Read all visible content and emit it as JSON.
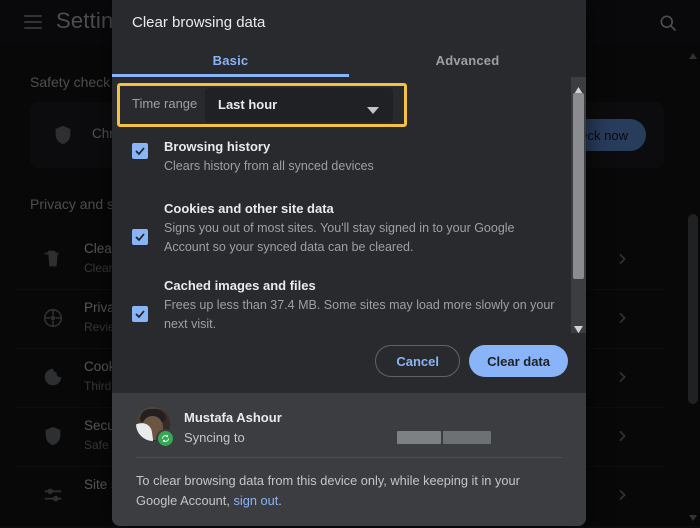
{
  "background": {
    "app_title": "Settings",
    "menu_icon": "hamburger-menu-icon",
    "search_icon": "search-icon",
    "safety_section_title": "Safety check",
    "safety_row_label": "Chro",
    "check_now_label": "eck now",
    "privacy_section_title": "Privacy and s",
    "rows": [
      {
        "title": "Clear",
        "subtitle": "Clear",
        "icon": "trash-icon"
      },
      {
        "title": "Priva",
        "subtitle": "Revie",
        "icon": "privacy-guide-icon"
      },
      {
        "title": "Cook",
        "subtitle": "Third",
        "icon": "cookie-icon"
      },
      {
        "title": "Secu",
        "subtitle": "Safe",
        "icon": "security-shield-icon"
      },
      {
        "title": "Site s",
        "subtitle": "",
        "icon": "site-settings-icon"
      }
    ]
  },
  "dialog": {
    "title": "Clear browsing data",
    "tabs": [
      {
        "label": "Basic",
        "active": true
      },
      {
        "label": "Advanced",
        "active": false
      }
    ],
    "time_range": {
      "label": "Time range",
      "value": "Last hour",
      "caret_icon": "chevron-down-icon",
      "highlight_color": "#f3c144"
    },
    "options": [
      {
        "title": "Browsing history",
        "description": "Clears history from all synced devices",
        "checked": true
      },
      {
        "title": "Cookies and other site data",
        "description": "Signs you out of most sites. You'll stay signed in to your Google Account so your synced data can be cleared.",
        "checked": true
      },
      {
        "title": "Cached images and files",
        "description": "Frees up less than 37.4 MB. Some sites may load more slowly on your next visit.",
        "checked": true
      }
    ],
    "actions": {
      "cancel_label": "Cancel",
      "clear_label": "Clear data"
    },
    "account": {
      "name": "Mustafa Ashour",
      "sync_status": "Syncing to",
      "sync_badge_icon": "sync-icon",
      "avatar": "user-avatar"
    },
    "footer_note_prefix": "To clear browsing data from this device only, while keeping it in your Google Account, ",
    "footer_link": "sign out",
    "footer_note_suffix": "."
  },
  "colors": {
    "accent_blue": "#8ab4f8",
    "highlight_yellow": "#f3c144",
    "dialog_bg": "#292a2d",
    "footer_bg": "#3b3d40",
    "page_bg": "#0f0f11",
    "sync_green": "#34a853"
  }
}
